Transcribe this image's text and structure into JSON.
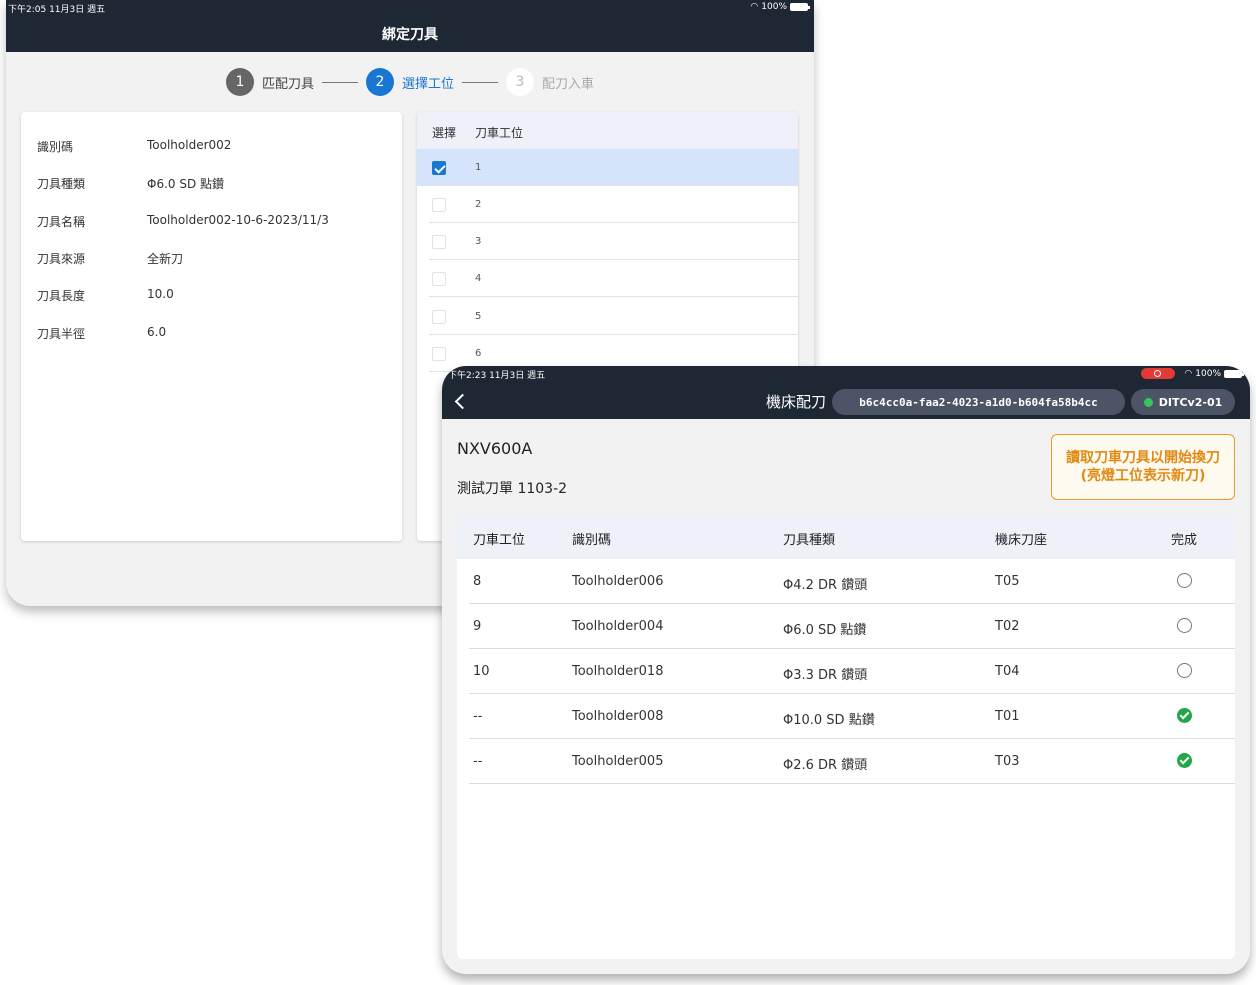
{
  "tablet1": {
    "status_bar": {
      "time": "下午2:05  11月3日 週五",
      "battery": "100%"
    },
    "title": "綁定刀具",
    "steps": [
      {
        "num": "1",
        "label": "匹配刀具"
      },
      {
        "num": "2",
        "label": "選擇工位"
      },
      {
        "num": "3",
        "label": "配刀入車"
      }
    ],
    "info": [
      {
        "label": "識別碼",
        "value": "Toolholder002"
      },
      {
        "label": "刀具種類",
        "value": "Φ6.0 SD 點鑽"
      },
      {
        "label": "刀具名稱",
        "value": "Toolholder002-10-6-2023/11/3"
      },
      {
        "label": "刀具來源",
        "value": "全新刀"
      },
      {
        "label": "刀具長度",
        "value": "10.0"
      },
      {
        "label": "刀具半徑",
        "value": "6.0"
      }
    ],
    "slot_table": {
      "headers": {
        "select": "選擇",
        "slot": "刀車工位"
      },
      "rows": [
        "1",
        "2",
        "3",
        "4",
        "5",
        "6"
      ],
      "selected": "1"
    }
  },
  "tablet2": {
    "status_bar": {
      "time": "下午2:23  11月3日 週五",
      "battery": "100%"
    },
    "title": "機床配刀",
    "session_id": "b6c4cc0a-faa2-4023-a1d0-b604fa58b4cc",
    "device": "DITCv2-01",
    "machine": "NXV600A",
    "order": "測試刀單 1103-2",
    "read_button": [
      "讀取刀車刀具以開始換刀",
      "(亮燈工位表示新刀)"
    ],
    "table": {
      "headers": [
        "刀車工位",
        "識別碼",
        "刀具種類",
        "機床刀座",
        "完成"
      ],
      "rows": [
        {
          "slot": "8",
          "id": "Toolholder006",
          "type": "Φ4.2 DR 鑽頭",
          "seat": "T05",
          "done": false
        },
        {
          "slot": "9",
          "id": "Toolholder004",
          "type": "Φ6.0 SD 點鑽",
          "seat": "T02",
          "done": false
        },
        {
          "slot": "10",
          "id": "Toolholder018",
          "type": "Φ3.3 DR 鑽頭",
          "seat": "T04",
          "done": false
        },
        {
          "slot": "--",
          "id": "Toolholder008",
          "type": "Φ10.0 SD 點鑽",
          "seat": "T01",
          "done": true
        },
        {
          "slot": "--",
          "id": "Toolholder005",
          "type": "Φ2.6 DR 鑽頭",
          "seat": "T03",
          "done": true
        }
      ]
    }
  },
  "colors": {
    "header_bg": "#1e2734",
    "accent": "#1976d2",
    "warning": "#e08a14",
    "success": "#22a64a"
  }
}
